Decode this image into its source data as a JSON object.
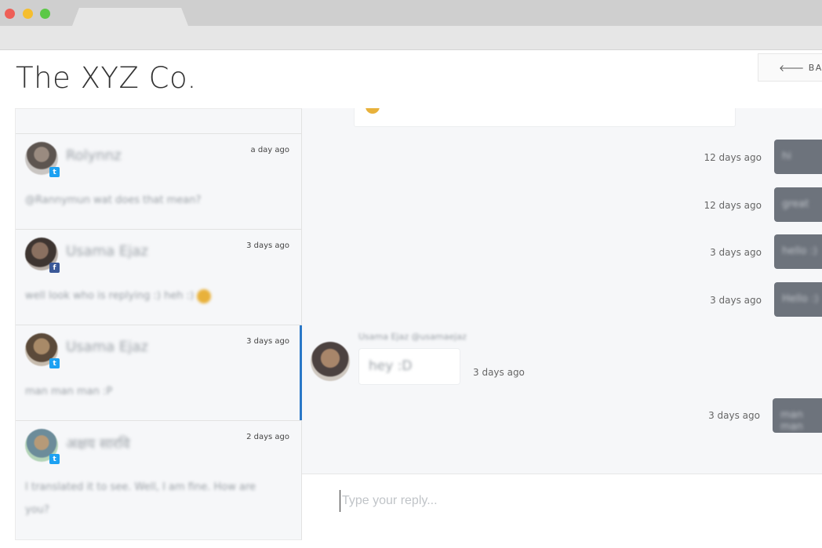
{
  "app": {
    "title": "The XYZ Co.",
    "back_label": "BACK"
  },
  "conversations": [
    {
      "name": "Rolynnz",
      "time": "a day ago",
      "message": "@Rannymun wat does that mean?",
      "network": "twitter"
    },
    {
      "name": "Usama Ejaz",
      "time": "3 days ago",
      "message": "well look who is replying :) heh :)",
      "network": "facebook"
    },
    {
      "name": "Usama Ejaz",
      "time": "3 days ago",
      "message": "man man man :P",
      "network": "twitter",
      "active": true
    },
    {
      "name": "अक्षय सारवि",
      "time": "2 days ago",
      "message": "I translated it to see. Well, I am fine. How are you?",
      "network": "twitter"
    }
  ],
  "thread": {
    "outgoing": [
      {
        "time": "12 days ago",
        "text": "hi"
      },
      {
        "time": "12 days ago",
        "text": "great"
      },
      {
        "time": "3 days ago",
        "text": "hello :)"
      },
      {
        "time": "3 days ago",
        "text": "Hello :)"
      }
    ],
    "incoming": {
      "sender": "Usama Ejaz @usamaejaz",
      "text": "hey :D",
      "time": "3 days ago"
    },
    "last_outgoing": {
      "time": "3 days ago",
      "text": "man man"
    }
  },
  "reply": {
    "placeholder": "Type your reply..."
  },
  "icons": {
    "back": "arrow-left-icon",
    "twitter": "twitter-icon",
    "facebook": "facebook-icon"
  },
  "colors": {
    "active_indicator": "#2a78c8",
    "outgoing_bubble": "#6d737c"
  }
}
